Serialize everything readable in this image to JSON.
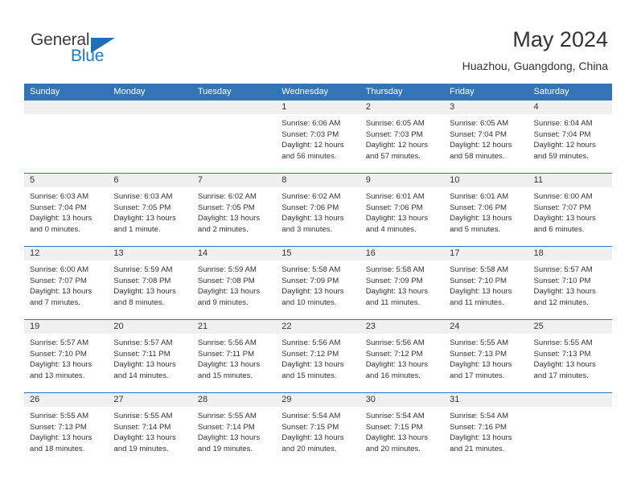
{
  "brand": {
    "name_part1": "General",
    "name_part2": "Blue",
    "triangle_icon": "triangle-logo-icon"
  },
  "header": {
    "title": "May 2024",
    "subtitle": "Huazhou, Guangdong, China"
  },
  "calendar": {
    "weekday_headers": [
      "Sunday",
      "Monday",
      "Tuesday",
      "Wednesday",
      "Thursday",
      "Friday",
      "Saturday"
    ],
    "accent_color": "#3274b5",
    "band_color": "#f0f0f0",
    "weeks": [
      [
        {
          "day": "",
          "sunrise": "",
          "sunset": "",
          "daylight1": "",
          "daylight2": ""
        },
        {
          "day": "",
          "sunrise": "",
          "sunset": "",
          "daylight1": "",
          "daylight2": ""
        },
        {
          "day": "",
          "sunrise": "",
          "sunset": "",
          "daylight1": "",
          "daylight2": ""
        },
        {
          "day": "1",
          "sunrise": "Sunrise: 6:06 AM",
          "sunset": "Sunset: 7:03 PM",
          "daylight1": "Daylight: 12 hours",
          "daylight2": "and 56 minutes."
        },
        {
          "day": "2",
          "sunrise": "Sunrise: 6:05 AM",
          "sunset": "Sunset: 7:03 PM",
          "daylight1": "Daylight: 12 hours",
          "daylight2": "and 57 minutes."
        },
        {
          "day": "3",
          "sunrise": "Sunrise: 6:05 AM",
          "sunset": "Sunset: 7:04 PM",
          "daylight1": "Daylight: 12 hours",
          "daylight2": "and 58 minutes."
        },
        {
          "day": "4",
          "sunrise": "Sunrise: 6:04 AM",
          "sunset": "Sunset: 7:04 PM",
          "daylight1": "Daylight: 12 hours",
          "daylight2": "and 59 minutes."
        }
      ],
      [
        {
          "day": "5",
          "sunrise": "Sunrise: 6:03 AM",
          "sunset": "Sunset: 7:04 PM",
          "daylight1": "Daylight: 13 hours",
          "daylight2": "and 0 minutes."
        },
        {
          "day": "6",
          "sunrise": "Sunrise: 6:03 AM",
          "sunset": "Sunset: 7:05 PM",
          "daylight1": "Daylight: 13 hours",
          "daylight2": "and 1 minute."
        },
        {
          "day": "7",
          "sunrise": "Sunrise: 6:02 AM",
          "sunset": "Sunset: 7:05 PM",
          "daylight1": "Daylight: 13 hours",
          "daylight2": "and 2 minutes."
        },
        {
          "day": "8",
          "sunrise": "Sunrise: 6:02 AM",
          "sunset": "Sunset: 7:06 PM",
          "daylight1": "Daylight: 13 hours",
          "daylight2": "and 3 minutes."
        },
        {
          "day": "9",
          "sunrise": "Sunrise: 6:01 AM",
          "sunset": "Sunset: 7:06 PM",
          "daylight1": "Daylight: 13 hours",
          "daylight2": "and 4 minutes."
        },
        {
          "day": "10",
          "sunrise": "Sunrise: 6:01 AM",
          "sunset": "Sunset: 7:06 PM",
          "daylight1": "Daylight: 13 hours",
          "daylight2": "and 5 minutes."
        },
        {
          "day": "11",
          "sunrise": "Sunrise: 6:00 AM",
          "sunset": "Sunset: 7:07 PM",
          "daylight1": "Daylight: 13 hours",
          "daylight2": "and 6 minutes."
        }
      ],
      [
        {
          "day": "12",
          "sunrise": "Sunrise: 6:00 AM",
          "sunset": "Sunset: 7:07 PM",
          "daylight1": "Daylight: 13 hours",
          "daylight2": "and 7 minutes."
        },
        {
          "day": "13",
          "sunrise": "Sunrise: 5:59 AM",
          "sunset": "Sunset: 7:08 PM",
          "daylight1": "Daylight: 13 hours",
          "daylight2": "and 8 minutes."
        },
        {
          "day": "14",
          "sunrise": "Sunrise: 5:59 AM",
          "sunset": "Sunset: 7:08 PM",
          "daylight1": "Daylight: 13 hours",
          "daylight2": "and 9 minutes."
        },
        {
          "day": "15",
          "sunrise": "Sunrise: 5:58 AM",
          "sunset": "Sunset: 7:09 PM",
          "daylight1": "Daylight: 13 hours",
          "daylight2": "and 10 minutes."
        },
        {
          "day": "16",
          "sunrise": "Sunrise: 5:58 AM",
          "sunset": "Sunset: 7:09 PM",
          "daylight1": "Daylight: 13 hours",
          "daylight2": "and 11 minutes."
        },
        {
          "day": "17",
          "sunrise": "Sunrise: 5:58 AM",
          "sunset": "Sunset: 7:10 PM",
          "daylight1": "Daylight: 13 hours",
          "daylight2": "and 11 minutes."
        },
        {
          "day": "18",
          "sunrise": "Sunrise: 5:57 AM",
          "sunset": "Sunset: 7:10 PM",
          "daylight1": "Daylight: 13 hours",
          "daylight2": "and 12 minutes."
        }
      ],
      [
        {
          "day": "19",
          "sunrise": "Sunrise: 5:57 AM",
          "sunset": "Sunset: 7:10 PM",
          "daylight1": "Daylight: 13 hours",
          "daylight2": "and 13 minutes."
        },
        {
          "day": "20",
          "sunrise": "Sunrise: 5:57 AM",
          "sunset": "Sunset: 7:11 PM",
          "daylight1": "Daylight: 13 hours",
          "daylight2": "and 14 minutes."
        },
        {
          "day": "21",
          "sunrise": "Sunrise: 5:56 AM",
          "sunset": "Sunset: 7:11 PM",
          "daylight1": "Daylight: 13 hours",
          "daylight2": "and 15 minutes."
        },
        {
          "day": "22",
          "sunrise": "Sunrise: 5:56 AM",
          "sunset": "Sunset: 7:12 PM",
          "daylight1": "Daylight: 13 hours",
          "daylight2": "and 15 minutes."
        },
        {
          "day": "23",
          "sunrise": "Sunrise: 5:56 AM",
          "sunset": "Sunset: 7:12 PM",
          "daylight1": "Daylight: 13 hours",
          "daylight2": "and 16 minutes."
        },
        {
          "day": "24",
          "sunrise": "Sunrise: 5:55 AM",
          "sunset": "Sunset: 7:13 PM",
          "daylight1": "Daylight: 13 hours",
          "daylight2": "and 17 minutes."
        },
        {
          "day": "25",
          "sunrise": "Sunrise: 5:55 AM",
          "sunset": "Sunset: 7:13 PM",
          "daylight1": "Daylight: 13 hours",
          "daylight2": "and 17 minutes."
        }
      ],
      [
        {
          "day": "26",
          "sunrise": "Sunrise: 5:55 AM",
          "sunset": "Sunset: 7:13 PM",
          "daylight1": "Daylight: 13 hours",
          "daylight2": "and 18 minutes."
        },
        {
          "day": "27",
          "sunrise": "Sunrise: 5:55 AM",
          "sunset": "Sunset: 7:14 PM",
          "daylight1": "Daylight: 13 hours",
          "daylight2": "and 19 minutes."
        },
        {
          "day": "28",
          "sunrise": "Sunrise: 5:55 AM",
          "sunset": "Sunset: 7:14 PM",
          "daylight1": "Daylight: 13 hours",
          "daylight2": "and 19 minutes."
        },
        {
          "day": "29",
          "sunrise": "Sunrise: 5:54 AM",
          "sunset": "Sunset: 7:15 PM",
          "daylight1": "Daylight: 13 hours",
          "daylight2": "and 20 minutes."
        },
        {
          "day": "30",
          "sunrise": "Sunrise: 5:54 AM",
          "sunset": "Sunset: 7:15 PM",
          "daylight1": "Daylight: 13 hours",
          "daylight2": "and 20 minutes."
        },
        {
          "day": "31",
          "sunrise": "Sunrise: 5:54 AM",
          "sunset": "Sunset: 7:16 PM",
          "daylight1": "Daylight: 13 hours",
          "daylight2": "and 21 minutes."
        },
        {
          "day": "",
          "sunrise": "",
          "sunset": "",
          "daylight1": "",
          "daylight2": ""
        }
      ]
    ]
  }
}
